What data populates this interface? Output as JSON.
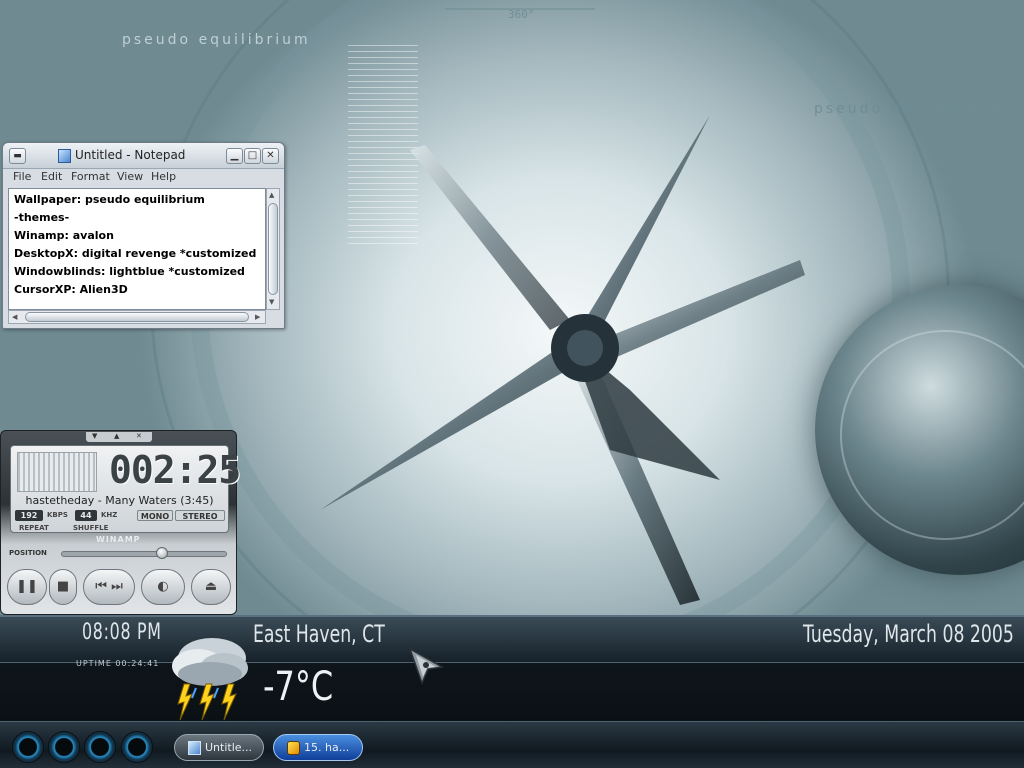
{
  "wallpaper": {
    "brand_top_left": "pseudo equilibrium",
    "brand_top_right": "pseudo equilibrium",
    "degree_mark": "360°"
  },
  "notepad": {
    "title": "Untitled - Notepad",
    "menu": [
      "File",
      "Edit",
      "Format",
      "View",
      "Help"
    ],
    "lines": [
      "Wallpaper:  pseudo  equilibrium",
      "-themes-",
      "Winamp:  avalon",
      "DesktopX:  digital  revenge  *customized",
      "Windowblinds:  lightblue  *customized",
      "CursorXP:  Alien3D"
    ]
  },
  "winamp": {
    "time": "002:25",
    "song": "hastetheday - Many Waters (3:45)",
    "kbps": "192",
    "kbps_label": "KBPS",
    "khz": "44",
    "khz_label": "KHZ",
    "mono": "MONO",
    "stereo": "STEREO",
    "repeat": "REPEAT",
    "shuffle": "SHUFFLE",
    "logo": "WINAMP",
    "position_label": "POSITION"
  },
  "dock": {
    "time": "08:08 PM",
    "uptime": "UPTIME 00:24:41",
    "city": "East Haven, CT",
    "temperature": "-7°C",
    "date": "Tuesday, March 08  2005",
    "weather_icon": "thunderstorm-icon"
  },
  "taskbar": {
    "tasks": [
      {
        "label": "Untitle...",
        "icon": "notepad-icon"
      },
      {
        "label": "15. ha...",
        "icon": "winamp-icon"
      }
    ]
  },
  "colors": {
    "accent_blue": "#2b8fc8",
    "task_active": "#2f66c4",
    "dock_background": "#0f161b"
  }
}
